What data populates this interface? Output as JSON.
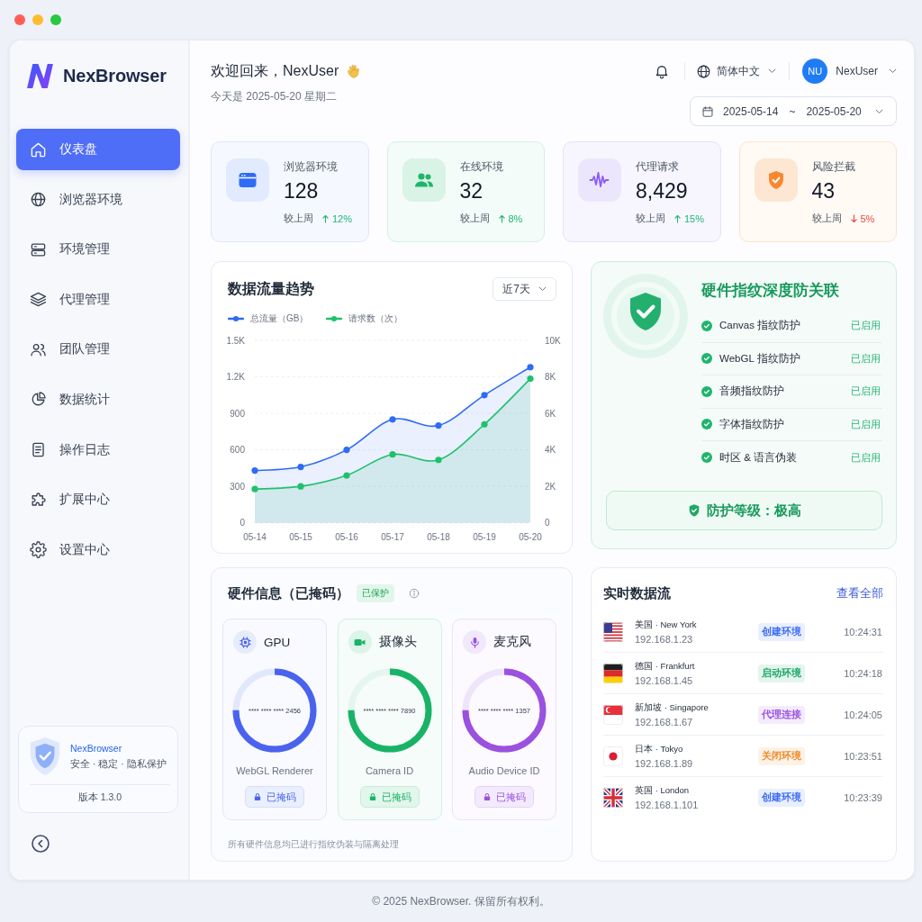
{
  "sidebar": {
    "logo": "NexBrowser",
    "items": [
      {
        "label": "仪表盘",
        "kind": "dashboard",
        "selected": true
      },
      {
        "label": "浏览器环境",
        "kind": "globe",
        "selected": false
      },
      {
        "label": "环境管理",
        "kind": "server",
        "selected": false
      },
      {
        "label": "代理管理",
        "kind": "layers",
        "selected": false
      },
      {
        "label": "团队管理",
        "kind": "team",
        "selected": false
      },
      {
        "label": "数据统计",
        "kind": "pie",
        "selected": false
      },
      {
        "label": "操作日志",
        "kind": "log",
        "selected": false
      },
      {
        "label": "扩展中心",
        "kind": "puzzle",
        "selected": false
      },
      {
        "label": "设置中心",
        "kind": "gear",
        "selected": false
      }
    ],
    "promo": {
      "title": "NexBrowser",
      "tagline": "安全 · 稳定 · 隐私保护",
      "version": "版本 1.3.0"
    }
  },
  "header": {
    "greeting": "欢迎回来，NexUser",
    "date_line": "今天是 2025-05-20 星期二",
    "language": "简体中文",
    "user": {
      "initials": "NU",
      "name": "NexUser"
    },
    "date_range": {
      "start": "2025-05-14",
      "separator": "~",
      "end": "2025-05-20"
    }
  },
  "stats": [
    {
      "kind": "browser",
      "label": "浏览器环境",
      "value": "128",
      "compare": "较上周",
      "delta": "12%",
      "rising": true
    },
    {
      "kind": "online",
      "label": "在线环境",
      "value": "32",
      "compare": "较上周",
      "delta": "8%",
      "rising": true
    },
    {
      "kind": "proxy",
      "label": "代理请求",
      "value": "8,429",
      "compare": "较上周",
      "delta": "15%",
      "rising": true
    },
    {
      "kind": "risk",
      "label": "风险拦截",
      "value": "43",
      "compare": "较上周",
      "delta": "5%",
      "rising": false
    }
  ],
  "traffic_chart": {
    "title": "数据流量趋势",
    "range": "近7天",
    "chart_data": {
      "type": "area",
      "grid": true,
      "categories": [
        "05-14",
        "05-15",
        "05-16",
        "05-17",
        "05-18",
        "05-19",
        "05-20"
      ],
      "series": [
        {
          "name": "总流量（GB）",
          "color": "#2f6bf5",
          "values": [
            430,
            460,
            600,
            850,
            800,
            1050,
            1280
          ]
        },
        {
          "name": "请求数（次）",
          "color": "#1fc16b",
          "axis": "y2",
          "values": [
            1850,
            2000,
            2600,
            3750,
            3450,
            5400,
            7900
          ]
        }
      ],
      "ylim": [
        0,
        1500
      ],
      "yticks": [
        {
          "value": 0,
          "label": "0"
        },
        {
          "value": 300,
          "label": "300"
        },
        {
          "value": 600,
          "label": "600"
        },
        {
          "value": 900,
          "label": "900"
        },
        {
          "value": 1200,
          "label": "1.2K"
        },
        {
          "value": 1500,
          "label": "1.5K"
        }
      ],
      "y2lim": [
        0,
        10000
      ],
      "y2ticks": [
        {
          "value": 0,
          "label": "0"
        },
        {
          "value": 2000,
          "label": "2K"
        },
        {
          "value": 4000,
          "label": "4K"
        },
        {
          "value": 6000,
          "label": "6K"
        },
        {
          "value": 8000,
          "label": "8K"
        },
        {
          "value": 10000,
          "label": "10K"
        }
      ]
    }
  },
  "fingerprint": {
    "title": "硬件指纹深度防关联",
    "items": [
      {
        "label": "Canvas 指纹防护",
        "status": "已启用",
        "on": true
      },
      {
        "label": "WebGL 指纹防护",
        "status": "已启用",
        "on": true
      },
      {
        "label": "音频指纹防护",
        "status": "已启用",
        "on": true
      },
      {
        "label": "字体指纹防护",
        "status": "已启用",
        "on": true
      },
      {
        "label": "时区 & 语言伪装",
        "status": "已启用",
        "on": true
      }
    ],
    "level_text": "防护等级：极高"
  },
  "hardware": {
    "title": "硬件信息（已掩码）",
    "badge": "已保护",
    "devices": [
      {
        "kind": "gpu",
        "name": "GPU",
        "masked_id": "**** **** **** 2456",
        "level": 0.75,
        "label": "WebGL Renderer",
        "button": "已掩码"
      },
      {
        "kind": "camera",
        "name": "摄像头",
        "masked_id": "**** **** **** 7890",
        "level": 0.75,
        "label": "Camera ID",
        "button": "已掩码"
      },
      {
        "kind": "mic",
        "name": "麦克风",
        "masked_id": "**** **** **** 1357",
        "level": 0.75,
        "label": "Audio Device ID",
        "button": "已掩码"
      }
    ],
    "note": "所有硬件信息均已进行指纹伪装与隔离处理"
  },
  "feed": {
    "title": "实时数据流",
    "link": "查看全部",
    "rows": [
      {
        "kind": "usa",
        "place": "美国 · New York",
        "ip": "192.168.1.23",
        "tag": "创建环境",
        "color": "#3b6cf6",
        "time": "10:24:31"
      },
      {
        "kind": "germany",
        "place": "德国 · Frankfurt",
        "ip": "192.168.1.45",
        "tag": "启动环境",
        "color": "#16a864",
        "time": "10:24:18"
      },
      {
        "kind": "singapore",
        "place": "新加坡 · Singapore",
        "ip": "192.168.1.67",
        "tag": "代理连接",
        "color": "#9b51e0",
        "time": "10:24:05"
      },
      {
        "kind": "japan",
        "place": "日本 · Tokyo",
        "ip": "192.168.1.89",
        "tag": "关闭环境",
        "color": "#f08a24",
        "time": "10:23:51"
      },
      {
        "kind": "uk",
        "place": "英国 · London",
        "ip": "192.168.1.101",
        "tag": "创建环境",
        "color": "#3b6cf6",
        "time": "10:23:39"
      }
    ]
  },
  "footer": "© 2025 NexBrowser. 保留所有权利。"
}
